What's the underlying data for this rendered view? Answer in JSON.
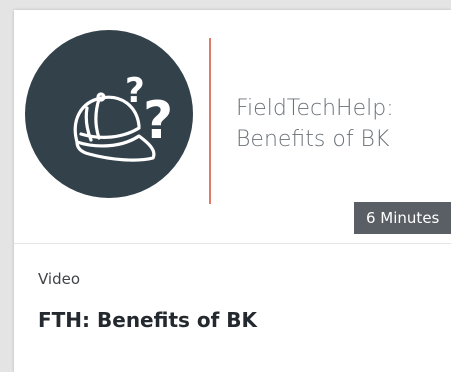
{
  "card": {
    "thumbnail": {
      "logo_icon": "cap-with-question-marks-icon",
      "title_line1": "FieldTechHelp:",
      "title_line2": "Benefits of BK",
      "duration": "6 Minutes"
    },
    "type": "Video",
    "title": "FTH: Benefits of BK"
  },
  "colors": {
    "logo_circle": "#33414b",
    "divider": "#e07b67",
    "duration_badge": "#595f64"
  }
}
